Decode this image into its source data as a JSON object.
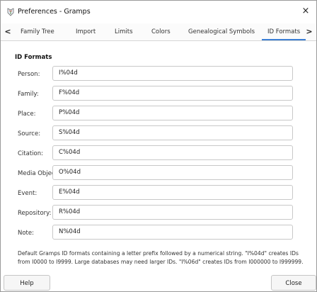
{
  "window": {
    "title": "Preferences - Gramps",
    "close_glyph": "×"
  },
  "tabs": {
    "left_arrow": "<",
    "right_arrow": ">",
    "items": [
      {
        "label": "Family Tree"
      },
      {
        "label": "Import"
      },
      {
        "label": "Limits"
      },
      {
        "label": "Colors"
      },
      {
        "label": "Genealogical Symbols"
      },
      {
        "label": "ID Formats",
        "active": true
      }
    ]
  },
  "section": {
    "title": "ID Formats"
  },
  "fields": [
    {
      "label": "Person:",
      "value": "I%04d"
    },
    {
      "label": "Family:",
      "value": "F%04d"
    },
    {
      "label": "Place:",
      "value": "P%04d"
    },
    {
      "label": "Source:",
      "value": "S%04d"
    },
    {
      "label": "Citation:",
      "value": "C%04d"
    },
    {
      "label": "Media Object:",
      "value": "O%04d"
    },
    {
      "label": "Event:",
      "value": "E%04d"
    },
    {
      "label": "Repository:",
      "value": "R%04d"
    },
    {
      "label": "Note:",
      "value": "N%04d"
    }
  ],
  "description": "Default Gramps ID formats containing a letter prefix followed by a numerical string. \"I%04d\" creates IDs from I0000 to I9999. Large databases may need larger IDs. \"I%06d\" creates IDs from I000000 to I999999.",
  "footer": {
    "help_label": "Help",
    "close_label": "Close"
  },
  "colors": {
    "accent": "#3b7fd6"
  },
  "icons": {
    "app": "gramps-app-icon",
    "close": "close-icon",
    "left": "chevron-left-icon",
    "right": "chevron-right-icon"
  }
}
